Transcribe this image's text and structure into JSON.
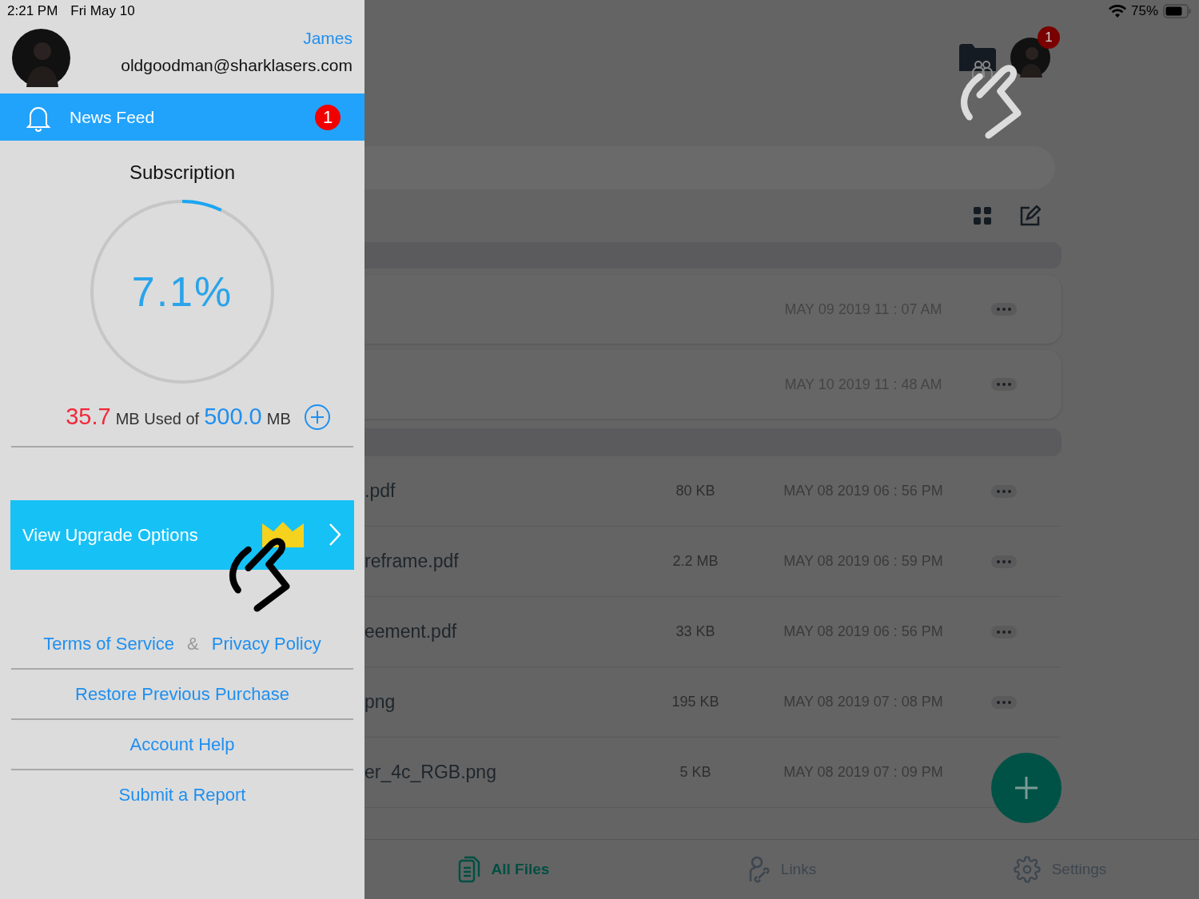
{
  "status_bar": {
    "time": "2:21 PM",
    "date": "Fri May 10",
    "battery": "75%"
  },
  "drawer": {
    "user_name": "James",
    "email": "oldgoodman@sharklasers.com",
    "news_feed": {
      "label": "News Feed",
      "badge": "1",
      "selected": true
    },
    "subscription": {
      "title": "Subscription",
      "percent": "7.1%",
      "level": 0.071,
      "used": "35.7",
      "used_text": "MB Used of",
      "total": "500.0",
      "total_unit": "MB"
    },
    "upgrade_button": "View Upgrade Options",
    "legal": {
      "terms": "Terms of Service",
      "separator": "&",
      "privacy": "Privacy Policy"
    },
    "menu": [
      "Restore Previous Purchase",
      "Account Help",
      "Submit a Report"
    ]
  },
  "main": {
    "profile_badge": "1",
    "folders": [
      {
        "date": "MAY 09 2019 11 : 07 AM"
      },
      {
        "date": "MAY 10 2019 11 : 48 AM"
      }
    ],
    "files": [
      {
        "name": ".pdf",
        "size": "80 KB",
        "date": "MAY 08 2019 06 : 56 PM"
      },
      {
        "name": "reframe.pdf",
        "size": "2.2 MB",
        "date": "MAY 08 2019 06 : 59 PM"
      },
      {
        "name": "eement.pdf",
        "size": "33 KB",
        "date": "MAY 08 2019 06 : 56 PM"
      },
      {
        "name": "png",
        "size": "195 KB",
        "date": "MAY 08 2019 07 : 08 PM"
      },
      {
        "name": "er_4c_RGB.png",
        "size": "5 KB",
        "date": "MAY 08 2019 07 : 09 PM"
      }
    ],
    "tabs": [
      {
        "kind": "files",
        "label": "All Files",
        "selected": true
      },
      {
        "kind": "links",
        "label": "Links",
        "selected": false
      },
      {
        "kind": "settings",
        "label": "Settings",
        "selected": false
      }
    ]
  }
}
